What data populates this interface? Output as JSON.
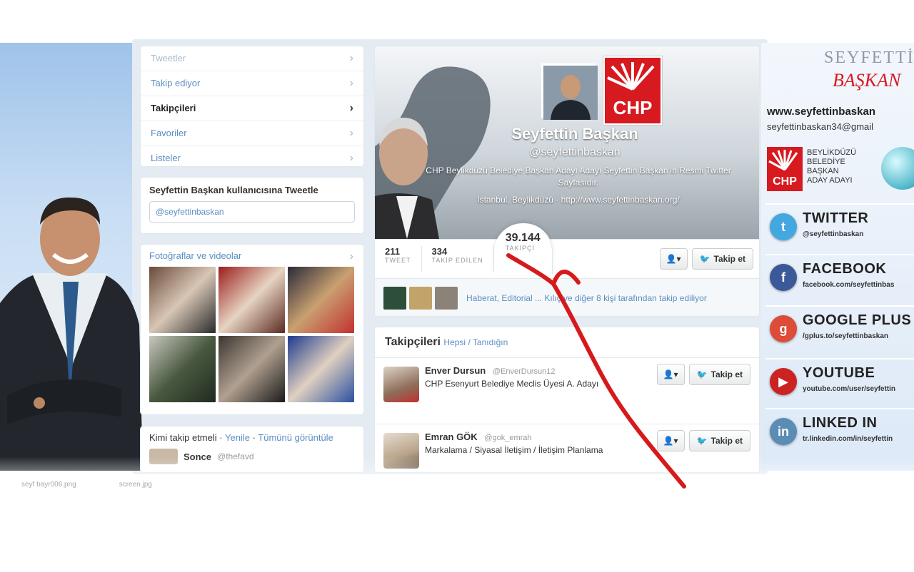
{
  "nav": {
    "items": [
      {
        "label": "Tweetler",
        "state": "faded"
      },
      {
        "label": "Takip ediyor",
        "state": "normal"
      },
      {
        "label": "Takipçileri",
        "state": "active"
      },
      {
        "label": "Favoriler",
        "state": "normal"
      },
      {
        "label": "Listeler",
        "state": "normal"
      }
    ],
    "chevron": "›"
  },
  "tweet_box": {
    "title": "Seyfettin Başkan kullanıcısına Tweetle",
    "value": "@seyfettinbaskan"
  },
  "photos": {
    "title": "Fotoğraflar ve videolar"
  },
  "who_to_follow": {
    "title": "Kimi takip etmeli",
    "refresh": "Yenile",
    "view_all": "Tümünü görüntüle",
    "name": "Sonce",
    "handle": "@thefavd"
  },
  "profile": {
    "name": "Seyfettin Başkan",
    "handle": "@seyfettinbaskan",
    "bio": "CHP Beylikdüzü Belediye Başkan Adayı Adayı Seyfettin Başkan'ın Resmi Twitter Sayfasıdır.",
    "location": "İstanbul, Beylikdüzü · http://www.seyfettinbaskan.org/",
    "chp_logo_text": "CHP",
    "stats": [
      {
        "num": "211",
        "label": "TWEET"
      },
      {
        "num": "334",
        "label": "TAKİP EDİLEN"
      }
    ],
    "followers": {
      "num": "39.144",
      "label": "TAKİPÇİ"
    },
    "follow_button": "Takip et",
    "user_menu": "▾",
    "mutual_text": "Haberat, Editorial ... Kılıç ve diğer 8 kişi tarafından takip ediliyor"
  },
  "followers_list": {
    "title": "Takipçileri",
    "sub_link_1": "Hepsi",
    "sub_sep": " / ",
    "sub_link_2": "Tanıdığın",
    "rows": [
      {
        "name": "Enver Dursun",
        "handle": "@EnverDursun12",
        "bio": "CHP Esenyurt Belediye Meclis Üyesi A. Adayı",
        "avatar_color": "#8d6e5a"
      },
      {
        "name": "Emran GÖK",
        "handle": "@gok_emrah",
        "bio": "Markalama / Siyasal İletişim / İletişim Planlama",
        "avatar_color": "#b9a48a"
      }
    ],
    "follow_button": "Takip et"
  },
  "right_banner": {
    "logo_line1": "SEYFETTİN",
    "logo_line2": "BAŞKAN",
    "website": "www.seyfettinbaskan",
    "email": "seyfettinbaskan34@gmail",
    "chp_text": "CHP",
    "candidate_lines": [
      "BEYLİKDÜZÜ",
      "BELEDİYE",
      "BAŞKAN",
      "ADAY ADAYI"
    ],
    "socials": [
      {
        "title": "TWITTER",
        "sub": "@seyfettinbaskan",
        "icon": "twitter-icon",
        "color": "#43a8e0"
      },
      {
        "title": "FACEBOOK",
        "sub": "facebook.com/seyfettinbas",
        "icon": "facebook-icon",
        "color": "#3b5998"
      },
      {
        "title": "GOOGLE PLUS",
        "sub": "/gplus.to/seyfettinbaskan",
        "icon": "google-plus-icon",
        "color": "#dd4b39"
      },
      {
        "title": "YOUTUBE",
        "sub": "youtube.com/user/seyfettin",
        "icon": "youtube-icon",
        "color": "#cc2222"
      },
      {
        "title": "LINKED IN",
        "sub": "tr.linkedin.com/in/seyfettin",
        "icon": "linkedin-icon",
        "color": "#5a8cb4"
      }
    ]
  },
  "bottom_bar": {
    "left": "seyf bayr006.png",
    "right": "screen.jpg"
  }
}
